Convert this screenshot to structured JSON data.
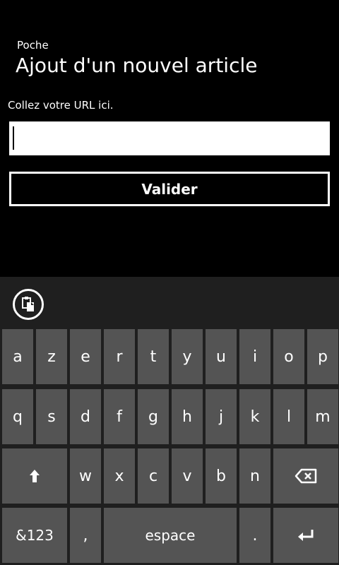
{
  "app": {
    "name": "Poche",
    "title": "Ajout d'un nouvel article"
  },
  "form": {
    "url_label": "Collez votre URL ici.",
    "url_value": "",
    "submit_label": "Valider"
  },
  "keyboard": {
    "toolbar_icon": "clipboard-paste-icon",
    "row1": [
      "a",
      "z",
      "e",
      "r",
      "t",
      "y",
      "u",
      "i",
      "o",
      "p"
    ],
    "row2": [
      "q",
      "s",
      "d",
      "f",
      "g",
      "h",
      "j",
      "k",
      "l",
      "m"
    ],
    "row3": [
      "w",
      "x",
      "c",
      "v",
      "b",
      "n"
    ],
    "shift_icon": "shift-arrow-up-icon",
    "backspace_icon": "backspace-icon",
    "numbers_label": "&123",
    "comma_label": ",",
    "space_label": "espace",
    "period_label": ".",
    "enter_icon": "enter-return-icon"
  },
  "colors": {
    "background": "#000000",
    "keyboard_background": "#1f1f1f",
    "key": "#545454",
    "text": "#ffffff"
  }
}
